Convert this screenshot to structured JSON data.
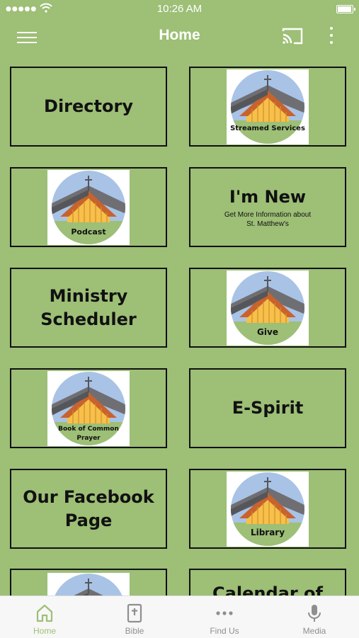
{
  "status_bar": {
    "time": "10:26 AM",
    "signal": "●●●●●"
  },
  "navbar": {
    "title": "Home"
  },
  "tiles": [
    {
      "label": "Directory"
    },
    {
      "caption": "Streamed Services"
    },
    {
      "caption": "Podcast"
    },
    {
      "label": "I'm New",
      "sub_line1": "Get More Information about",
      "sub_line2": "St. Matthew's"
    },
    {
      "label_line1": "Ministry",
      "label_line2": "Scheduler"
    },
    {
      "caption": "Give"
    },
    {
      "caption_line1": "Book of Common",
      "caption_line2": "Prayer"
    },
    {
      "label": "E-Spirit"
    },
    {
      "label_line1": "Our Facebook",
      "label_line2": "Page"
    },
    {
      "caption": "Library"
    },
    {
      "partial": ""
    },
    {
      "label_partial": "Calendar of"
    }
  ],
  "tabs": [
    {
      "label": "Home",
      "icon": "home-icon",
      "active": true
    },
    {
      "label": "Bible",
      "icon": "bible-icon"
    },
    {
      "label": "Find Us",
      "icon": "more-dots-icon"
    },
    {
      "label": "Media",
      "icon": "microphone-icon"
    }
  ],
  "colors": {
    "background": "#9dbf76",
    "tab_active": "#9dbf76",
    "tab_inactive": "#8f8f8f"
  }
}
